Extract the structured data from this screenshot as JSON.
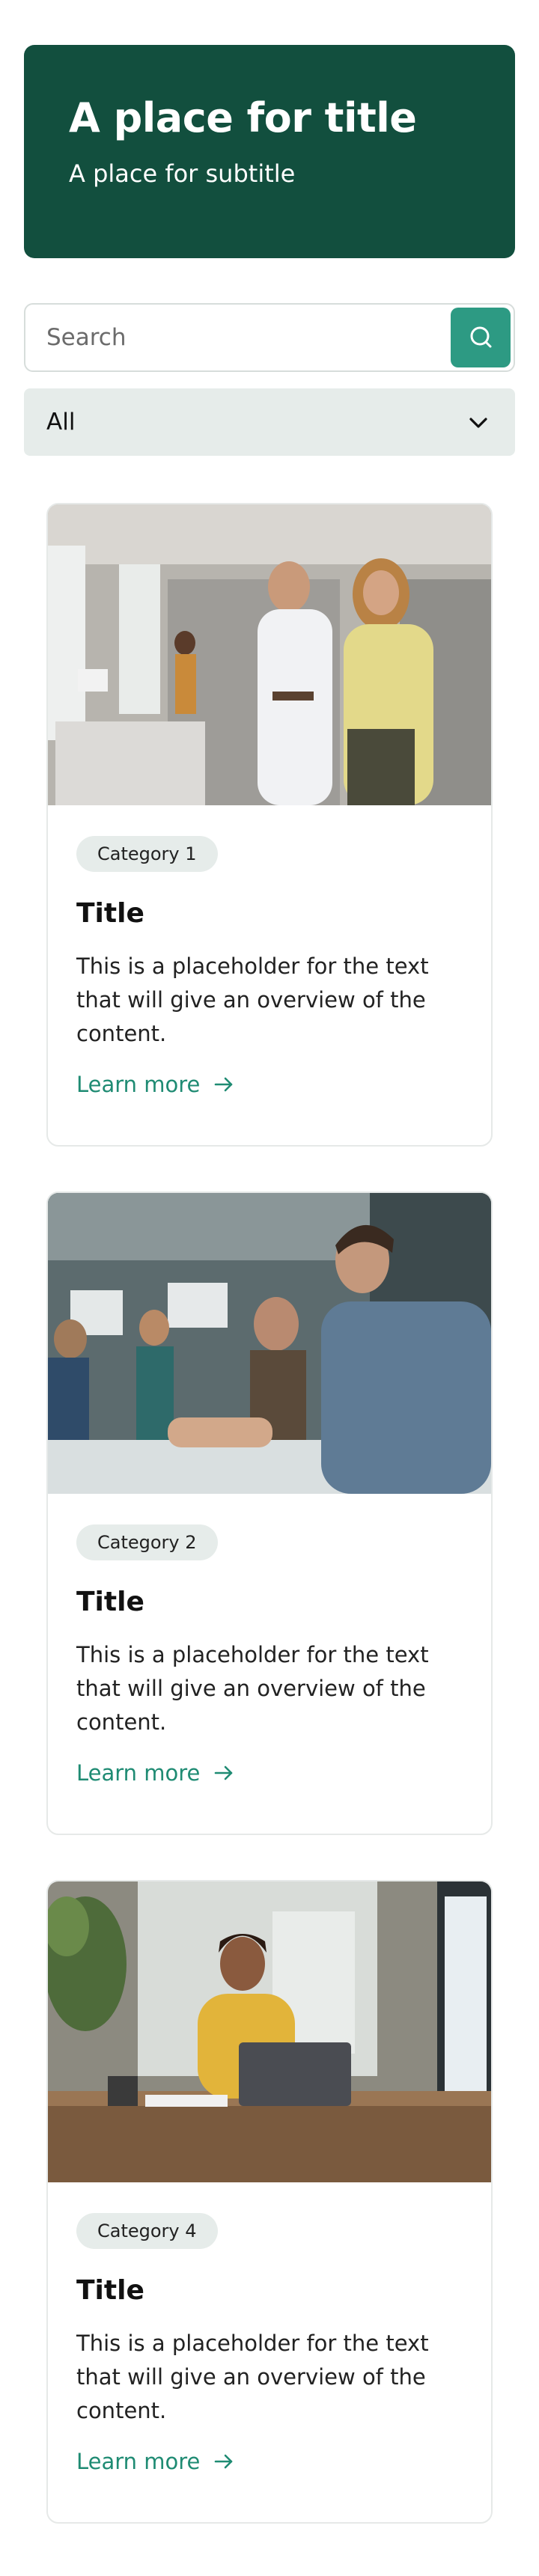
{
  "hero": {
    "title": "A place for title",
    "subtitle": "A place for subtitle"
  },
  "search": {
    "placeholder": "Search",
    "value": "",
    "icon": "search-icon"
  },
  "filter": {
    "selected": "All",
    "icon": "chevron-down-icon"
  },
  "cards": [
    {
      "category": "Category 1",
      "title": "Title",
      "text": "This is a placeholder for the text that will give an overview of the content.",
      "link": "Learn more",
      "image": "two colleagues looking at a tablet in an office"
    },
    {
      "category": "Category 2",
      "title": "Title",
      "text": "This is a placeholder for the text that will give an overview of the content.",
      "link": "Learn more",
      "image": "team meeting around a conference table"
    },
    {
      "category": "Category 4",
      "title": "Title",
      "text": "This is a placeholder for the text that will give an overview of the content.",
      "link": "Learn more",
      "image": "woman working on a laptop at a desk"
    }
  ],
  "colors": {
    "hero_bg": "#124f3e",
    "accent": "#2d9a83",
    "link": "#1f8b73",
    "filter_bg": "#e6ecea",
    "badge_bg": "#e6ecea"
  }
}
